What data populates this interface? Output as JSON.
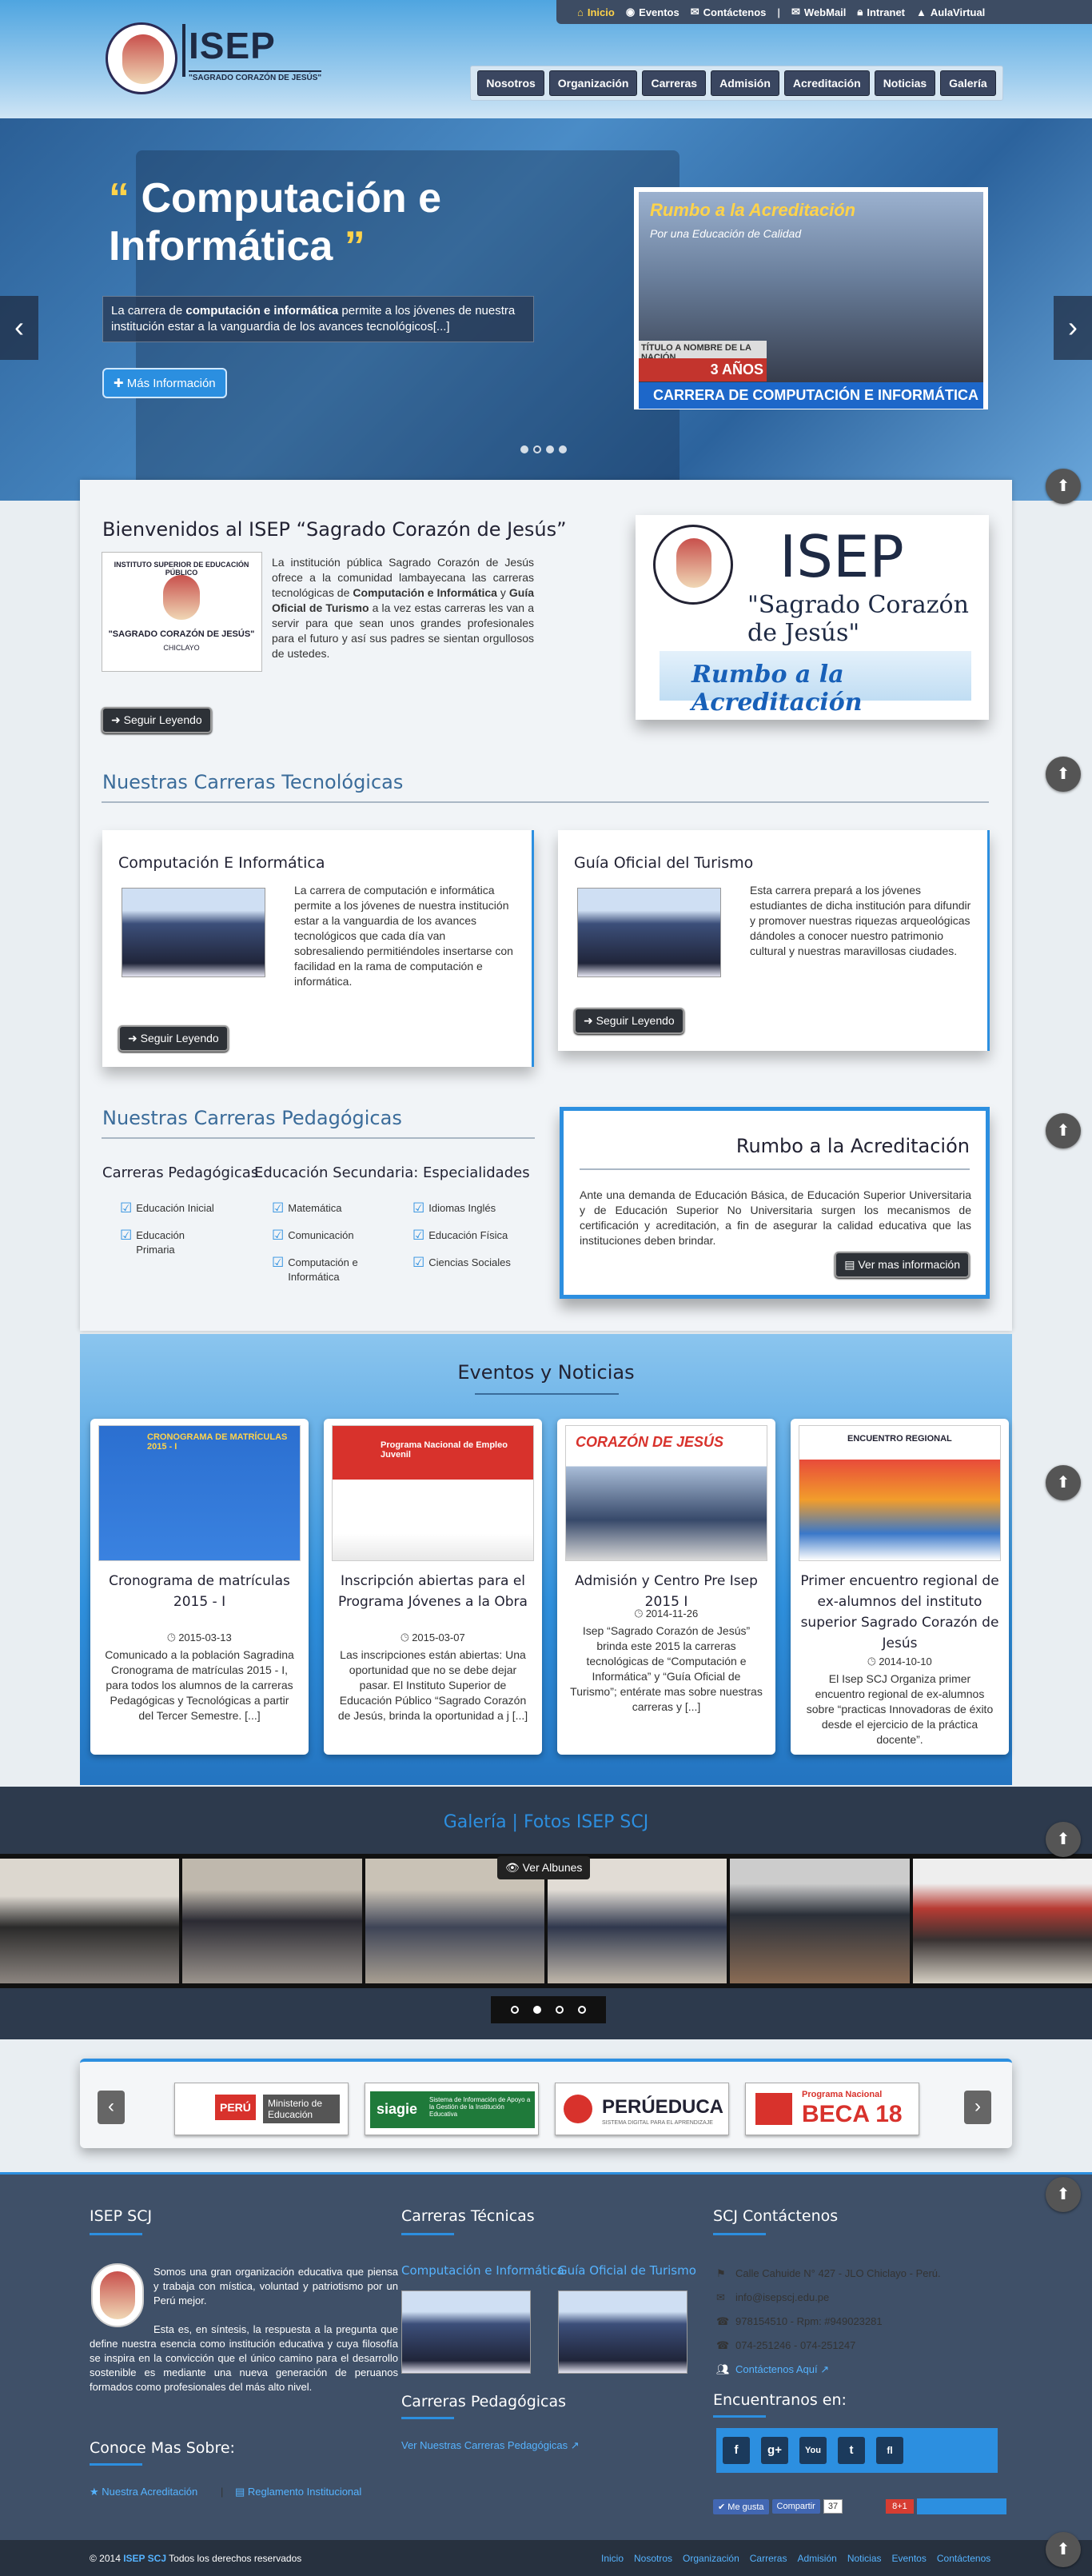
{
  "util_nav": {
    "items": [
      {
        "icon": "home-icon",
        "label": "Inicio",
        "active": true
      },
      {
        "icon": "globe-icon",
        "label": "Eventos"
      },
      {
        "icon": "envelope-icon",
        "label": "Contáctenos"
      },
      {
        "icon": "",
        "label": "|"
      },
      {
        "icon": "mail-icon",
        "label": "WebMail"
      },
      {
        "icon": "lock-icon",
        "label": "Intranet"
      },
      {
        "icon": "graduation-icon",
        "label": "AulaVirtual"
      }
    ]
  },
  "header": {
    "logo_text": "ISEP",
    "logo_subtext": "\"SAGRADO CORAZÓN DE JESÚS\"",
    "nav": [
      "Nosotros",
      "Organización",
      "Carreras",
      "Admisión",
      "Acreditación",
      "Noticias",
      "Galería"
    ]
  },
  "slider": {
    "quote_open": "“",
    "title_line1": "Computación e",
    "title_line2": "Informática",
    "quote_close": "”",
    "description_prefix": "La carrera de ",
    "description_bold": "computación e informática",
    "description_suffix": " permite a los jóvenes de nuestra institución estar a la vanguardia de los avances tecnológicos[...]",
    "button": "Más Información",
    "photo": {
      "banner_line1": "Rumbo a la Acreditación",
      "banner_line2": "Por una Educación de Calidad",
      "caption_title": "TÍTULO A NOMBRE DE LA NACIÓN",
      "caption_years": "3 AÑOS",
      "caption_career": "CARRERA DE COMPUTACIÓN E INFORMÁTICA"
    },
    "prev": "‹",
    "next": "›"
  },
  "welcome": {
    "title": "Bienvenidos al ISEP “Sagrado Corazón de Jesús”",
    "logo_top": "INSTITUTO SUPERIOR DE EDUCACIÓN PÚBLICO",
    "logo_name": "\"SAGRADO CORAZÓN DE JESÚS\"",
    "logo_city": "CHICLAYO",
    "text_a": "La institución pública Sagrado Corazón de Jesús ofrece a la comunidad lambayecana las carreras tecnológicas de ",
    "text_b": "Computación e Informática",
    "text_c": " y ",
    "text_d": "Guía Oficial de Turismo",
    "text_e": " a la vez estas carreras les van a servir para que sean unos grandes profesionales para el futuro y así sus padres se sientan orgullosos de ustedes.",
    "button": "Seguir Leyendo",
    "card_big": "ISEP",
    "card_mid": "\"Sagrado Corazón de Jesús\"",
    "card_rumbo": "Rumbo a la Acreditación"
  },
  "tech": {
    "title": "Nuestras Carreras Tecnológicas",
    "cards": [
      {
        "title": "Computación E Informática",
        "text": "La carrera de computación e informática permite a los jóvenes de nuestra institución estar a la vanguardia de los avances tecnológicos que cada día van sobresaliendo permitiéndoles insertarse con facilidad en la rama de computación e informática.",
        "button": "Seguir Leyendo"
      },
      {
        "title": "Guía Oficial del Turismo",
        "text": "Esta carrera prepará a los jóvenes estudiantes de dicha institución para difundir y promover nuestras riquezas arqueológicas dándoles a conocer nuestro patrimonio cultural y nuestras maravillosas ciudades.",
        "button": "Seguir Leyendo"
      }
    ]
  },
  "pedag": {
    "title": "Nuestras Carreras Pedagógicas",
    "col1_title": "Carreras Pedagógicas",
    "col1": [
      "Educación Inicial",
      "Educación Primaria"
    ],
    "col2_title": "Educación Secundaria: Especialidades",
    "col2a": [
      "Matemática",
      "Comunicación",
      "Computación e Informática"
    ],
    "col2b": [
      "Idiomas Inglés",
      "Educación Física",
      "Ciencias Sociales"
    ]
  },
  "acred": {
    "title": "Rumbo a la Acreditación",
    "text": "Ante una demanda de Educación Básica, de Educación Superior Universitaria y de Educación Superior No Universitaria surgen los mecanismos de certificación y acreditación, a fin de asegurar la calidad educativa que las instituciones deben brindar.",
    "button": "Ver mas información"
  },
  "events": {
    "title": "Eventos y Noticias",
    "items": [
      {
        "title": "Cronograma de matrículas 2015 - I",
        "date": "2015-03-13",
        "text": "Comunicado a la población Sagradina Cronograma de matrículas 2015 - I, para todos los alumnos de la carreras Pedagógicas y Tecnológicas a partir del Tercer Semestre. [...]",
        "img": "CRONOGRAMA DE MATRÍCULAS 2015 - I"
      },
      {
        "title": "Inscripción abiertas para el Programa Jóvenes a la Obra",
        "date": "2015-03-07",
        "text": "Las inscripciones están abiertas: Una oportunidad que no se debe dejar pasar. El Instituto Superior de Educación Público “Sagrado Corazón de Jesús, brinda la oportunidad a j [...]",
        "img": "Programa Nacional de Empleo Juvenil"
      },
      {
        "title": "Admisión y Centro Pre Isep 2015 I",
        "date": "2014-11-26",
        "text": "Isep “Sagrado Corazón de Jesús” brinda este 2015 la carreras tecnológicas de “Computación e Informática” y “Guía Oficial de Turismo”; entérate mas sobre nuestras carreras y [...]",
        "img": "CORAZÓN DE JESÚS"
      },
      {
        "title": "Primer encuentro regional de ex-alumnos del instituto superior Sagrado Corazón de Jesús",
        "date": "2014-10-10",
        "text": "El Isep SCJ Organiza primer encuentro regional de ex-alumnos sobre “practicas Innovadoras de éxito desde el ejercicio de la práctica docente”.",
        "img": "ENCUENTRO REGIONAL"
      }
    ]
  },
  "gallery": {
    "title": "Galería | Fotos ISEP SCJ",
    "button": "Ver Albunes"
  },
  "partners": {
    "logos": [
      {
        "a": "PERÚ",
        "b": "Ministerio de Educación"
      },
      {
        "a": "siagie",
        "b": "Sistema de Información de Apoyo a la Gestión de la Institución Educativa"
      },
      {
        "a": "PERÚEDUCA",
        "b": "SISTEMA DIGITAL PARA EL APRENDIZAJE"
      },
      {
        "a": "BECA 18",
        "b": "Programa Nacional"
      }
    ]
  },
  "footer": {
    "col1_title": "ISEP SCJ",
    "col1_text1": "Somos una gran organización educativa que piensa y trabaja con mística, voluntad y patriotismo por un Perú mejor.",
    "col1_text2": "Esta es, en síntesis, la respuesta a la pregunta que define nuestra esencia como institución educativa y cuya filosofía se inspira en la convicción que el único camino para el desarrollo sostenible es mediante una nueva generación de peruanos formados como profesionales del más alto nivel.",
    "more_title": "Conoce Mas Sobre:",
    "more_link1": "Nuestra Acreditación",
    "more_sep": "|",
    "more_link2": "Reglamento Institucional",
    "col2_title": "Carreras Técnicas",
    "col2_link1": "Computación e Informática",
    "col2_link2": "Guía Oficial de Turismo",
    "col2b_title": "Carreras Pedagógicas",
    "col2b_link": "Ver Nuestras Carreras Pedagógicas",
    "col3_title": "SCJ Contáctenos",
    "contacts": [
      {
        "icon": "map-marker-icon",
        "text": "Calle Cahuide N° 427 - JLO Chiclayo - Perú."
      },
      {
        "icon": "envelope-icon",
        "text": "info@isepscj.edu.pe"
      },
      {
        "icon": "phone-icon",
        "text": "978154510 - Rpm: #949023281"
      },
      {
        "icon": "phone-icon",
        "text": "074-251246 - 074-251247"
      },
      {
        "icon": "group-icon",
        "text": "Contáctenos Aquí"
      }
    ],
    "find_title": "Encuentranos en:",
    "social": [
      "f",
      "g+",
      "You",
      "t",
      "fl"
    ],
    "like": "Me gusta",
    "share": "Compartir",
    "count": "37",
    "gplus": "8+1"
  },
  "bottom": {
    "copy_a": "© 2014 ",
    "copy_b": "ISEP SCJ",
    "copy_c": " Todos los derechos reservados",
    "links": [
      "Inicio",
      "Nosotros",
      "Organización",
      "Carreras",
      "Admisión",
      "Noticias",
      "Eventos",
      "Contáctenos"
    ]
  },
  "colors": {
    "accent": "#2c8fe0",
    "dark": "#3d4c63",
    "footer": "#3f5068"
  }
}
